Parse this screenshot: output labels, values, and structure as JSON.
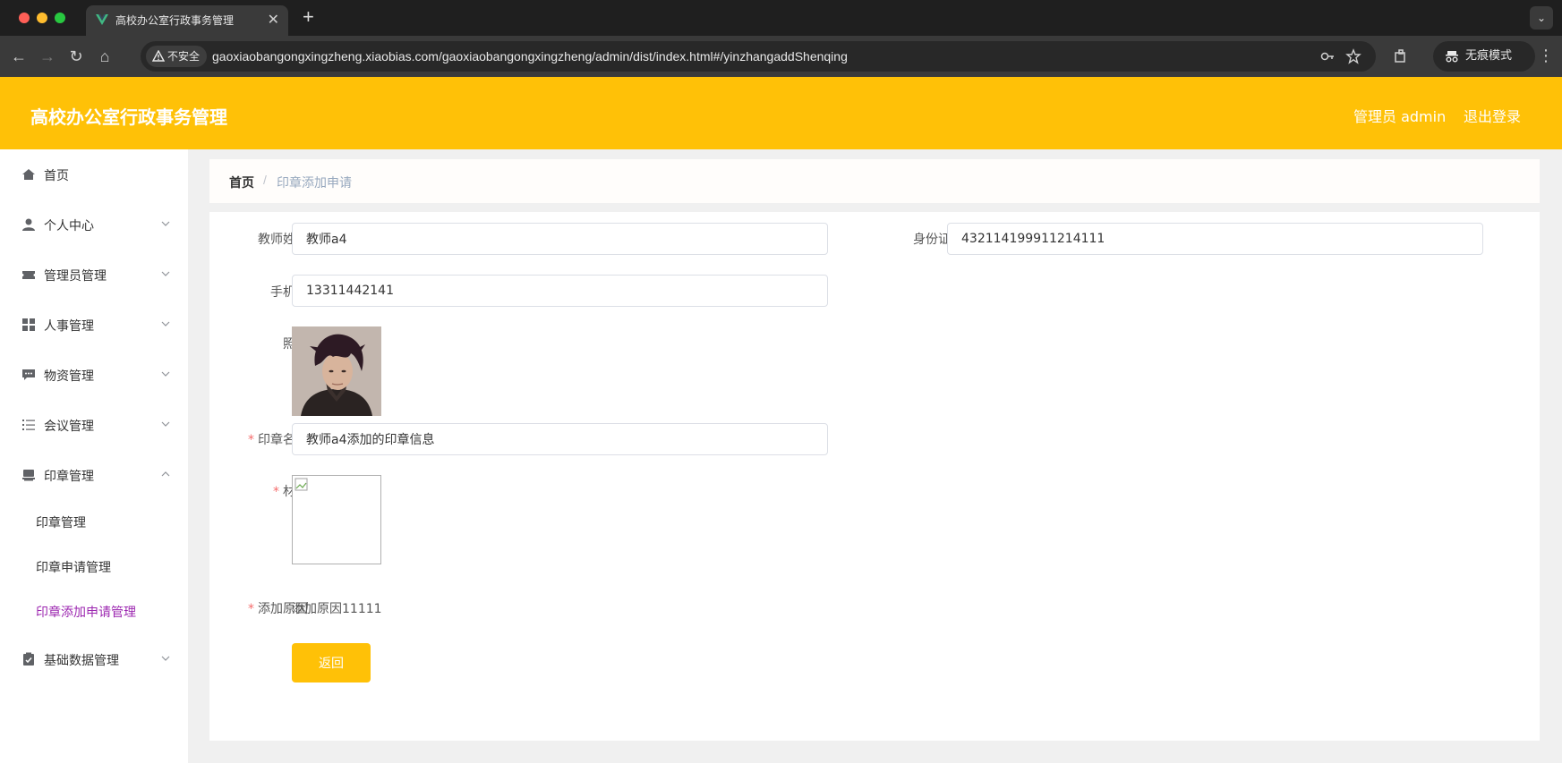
{
  "browser": {
    "tab_title": "高校办公室行政事务管理",
    "insecure_label": "不安全",
    "url": "gaoxiaobangongxingzheng.xiaobias.com/gaoxiaobangongxingzheng/admin/dist/index.html#/yinzhangaddShenqing",
    "incognito_label": "无痕模式"
  },
  "header": {
    "title": "高校办公室行政事务管理",
    "user": "管理员 admin",
    "logout": "退出登录",
    "bg_color": "#ffc107"
  },
  "sidebar": {
    "items": [
      {
        "label": "首页",
        "icon": "home-icon"
      },
      {
        "label": "个人中心",
        "icon": "user-icon"
      },
      {
        "label": "管理员管理",
        "icon": "ticket-icon"
      },
      {
        "label": "人事管理",
        "icon": "grid-icon"
      },
      {
        "label": "物资管理",
        "icon": "chat-icon"
      },
      {
        "label": "会议管理",
        "icon": "list-icon"
      },
      {
        "label": "印章管理",
        "icon": "stamp-icon"
      },
      {
        "label": "基础数据管理",
        "icon": "clipboard-icon"
      }
    ],
    "sub_items": [
      {
        "label": "印章管理"
      },
      {
        "label": "印章申请管理"
      },
      {
        "label": "印章添加申请管理",
        "active": true
      }
    ],
    "active_color": "#9c27b0"
  },
  "breadcrumb": {
    "home": "首页",
    "separator": "/",
    "current": "印章添加申请"
  },
  "form": {
    "teacher_name": {
      "label": "教师姓名",
      "value": "教师a4"
    },
    "id_number": {
      "label": "身份证号",
      "value": "432114199911214111"
    },
    "phone": {
      "label": "手机号",
      "value": "13311442141"
    },
    "photo": {
      "label": "照片"
    },
    "seal_name": {
      "label": "印章名称",
      "value": "教师a4添加的印章信息",
      "required": "*"
    },
    "material": {
      "label": "材料",
      "required": "*"
    },
    "reason": {
      "label": "添加原因",
      "value": "添加原因11111",
      "required": "*"
    },
    "back_button": "返回"
  }
}
